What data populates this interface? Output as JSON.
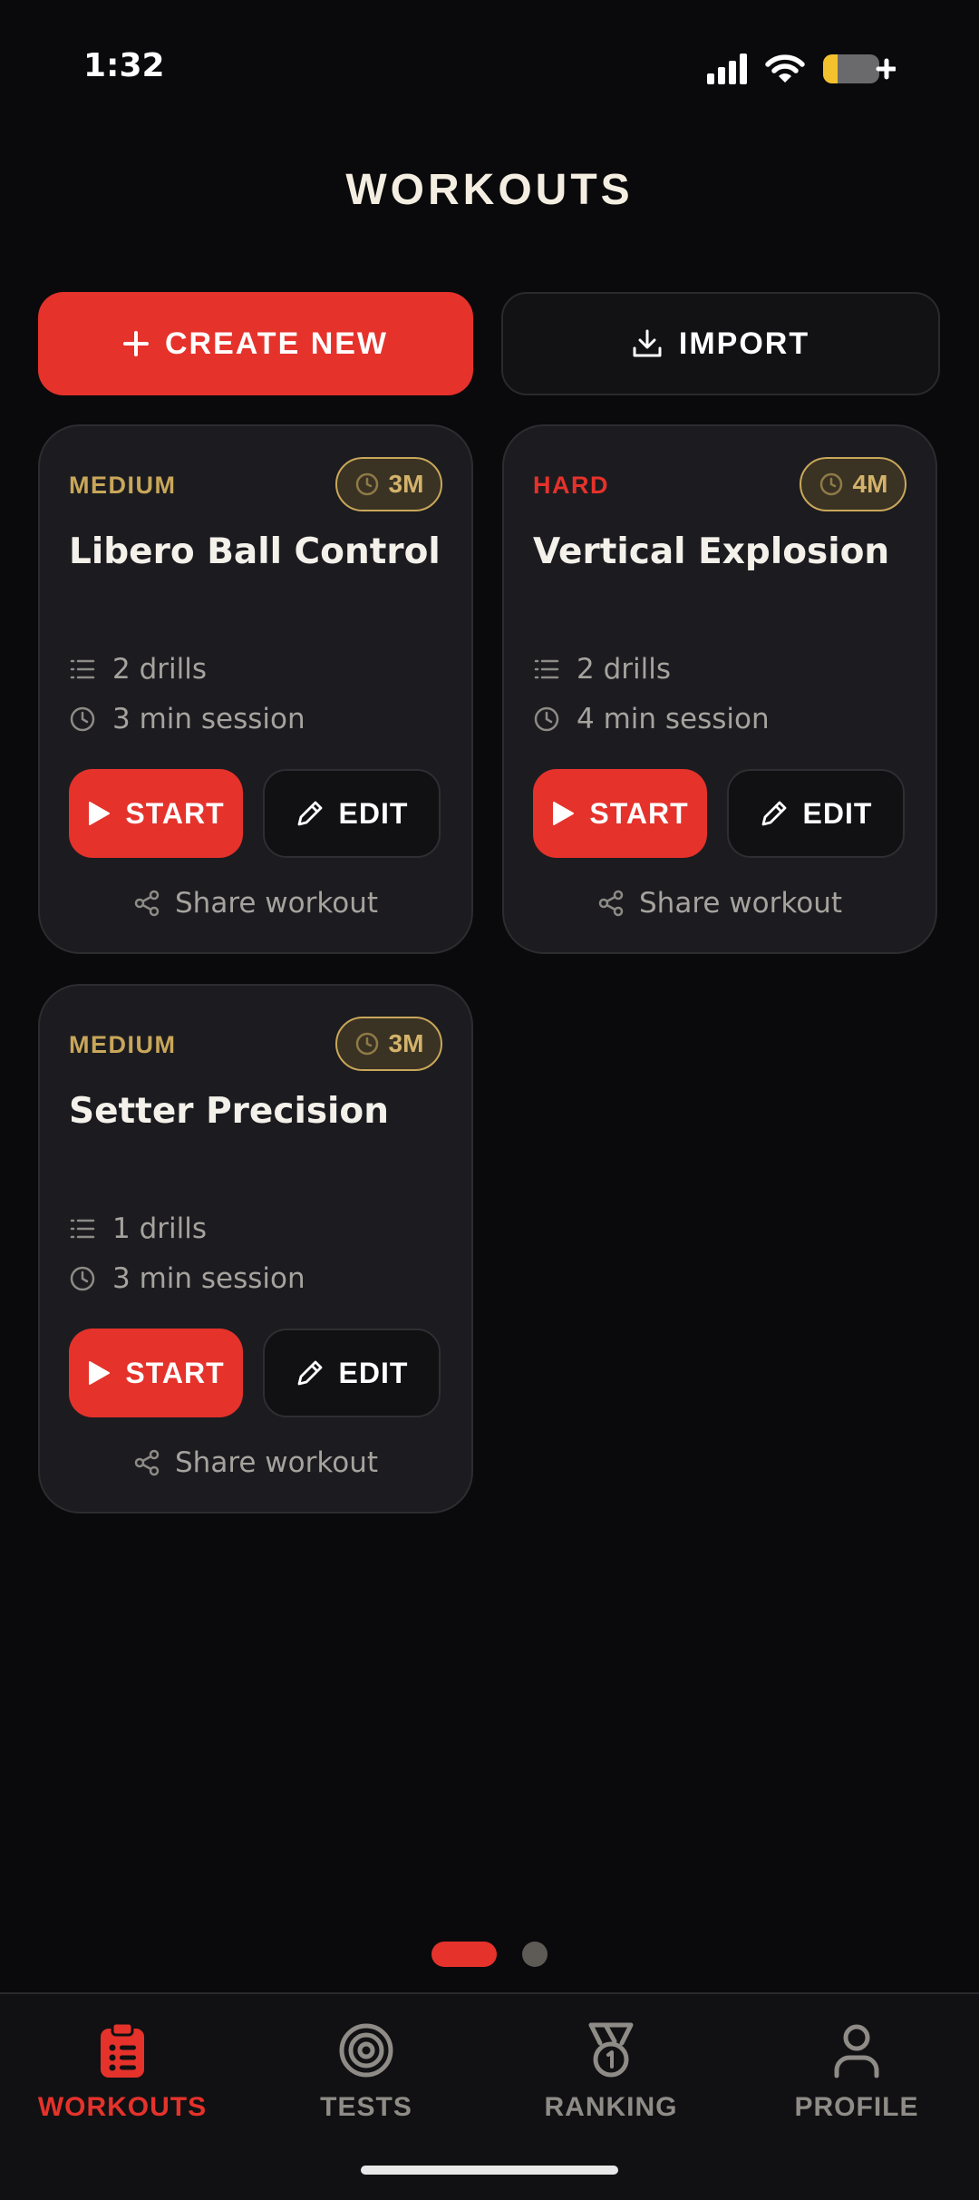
{
  "status_bar": {
    "time": "1:32"
  },
  "page": {
    "title": "WORKOUTS"
  },
  "actions": {
    "create_label": "CREATE NEW",
    "import_label": "IMPORT"
  },
  "workouts": [
    {
      "difficulty": "MEDIUM",
      "difficulty_color": "#c9a75a",
      "duration_badge": "3M",
      "title": "Libero Ball Control",
      "drills": "2 drills",
      "session": "3 min session",
      "start_label": "START",
      "edit_label": "EDIT",
      "share_label": "Share workout"
    },
    {
      "difficulty": "HARD",
      "difficulty_color": "#e5322b",
      "duration_badge": "4M",
      "title": "Vertical Explosion",
      "drills": "2 drills",
      "session": "4 min session",
      "start_label": "START",
      "edit_label": "EDIT",
      "share_label": "Share workout"
    },
    {
      "difficulty": "MEDIUM",
      "difficulty_color": "#c9a75a",
      "duration_badge": "3M",
      "title": "Setter Precision",
      "drills": "1 drills",
      "session": "3 min session",
      "start_label": "START",
      "edit_label": "EDIT",
      "share_label": "Share workout"
    }
  ],
  "pagination": {
    "pages": 2,
    "active": 1
  },
  "tabs": [
    {
      "label": "WORKOUTS",
      "icon": "clipboard-icon",
      "active": true
    },
    {
      "label": "TESTS",
      "icon": "target-icon",
      "active": false
    },
    {
      "label": "RANKING",
      "icon": "medal-icon",
      "active": false
    },
    {
      "label": "PROFILE",
      "icon": "user-icon",
      "active": false
    }
  ],
  "colors": {
    "accent": "#e5322b",
    "gold": "#c9a75a",
    "background": "#0a0a0c",
    "card": "#1c1c20",
    "tab_inactive": "#8f8c87"
  }
}
